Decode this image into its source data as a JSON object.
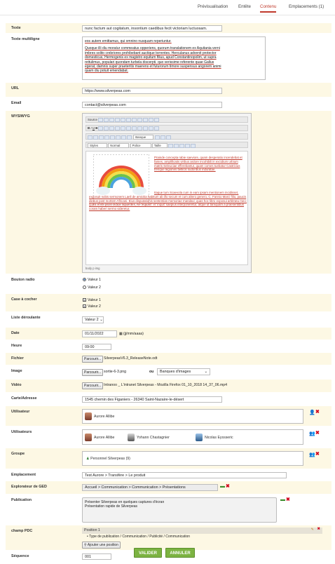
{
  "tabs": [
    {
      "label": "Prévisualisation"
    },
    {
      "label": "Entête"
    },
    {
      "label": "Contenu"
    },
    {
      "label": "Emplacements (1)"
    }
  ],
  "fields": {
    "texte": {
      "label": "Texte",
      "value": "nunc factum aut cogitatum, insontium caedibus fecit victoriam luctuosam."
    },
    "multiline": {
      "label": "Texte multiligne",
      "lines": [
        "eos autem emittamus, qui omnino nusquam reperiuntur.",
        "Quoque illi diu moratur commeatus opperiens, quorum translationem ex Aquitania verni",
        "imbres solito crebriores prohibebant auctique torrentes. Herculanus advenit protector",
        "domesticus, Hermogenis ex magistro equitum filius, apud Constantinopolim, ut supra",
        "rettulimus, populari quondam turbela discerpti. quo verissime referente quae Gallus",
        "egerat, damnis super praeteritis maerens et futurorum timore suspensus angorem animi",
        "quam diu potuit emendabat."
      ]
    },
    "url": {
      "label": "URL",
      "value": "https://www.silverpeas.com"
    },
    "email": {
      "label": "Email",
      "value": "contact@silverpeas.com"
    },
    "wysiwyg": {
      "label": "WYSIWYG",
      "toolbar": {
        "source": "Source",
        "font": "Banque",
        "styles": "Styles",
        "format": "Normal",
        "police": "Police",
        "size": "Taille"
      },
      "para1": "Prainde concepta rabie saeviore, quam desperatio incendebat et fames, amplificatis viribus ardore incohibili in excidium urbium matris Seleuciae efferebantur, quam comes tuebatur Castricius tresque legiones bellicis sudoribus induratae.",
      "para2": "Itaque tum Scaevola cum in eam ipsam mentionem incidisset, exposuit nobis sermonem Laeli de amicitia habitum ab illo secum et cum altero genero, C. Fannio Marci filio, paucis diebus post mortem Africani. Eius disputationis sententias memoriae mandavi, quas hoc libro exposui arbitratu meo; quasi enim ipsos induxi loquentes, ne 'inquam' et 'inquit' saepius interponeretur, atque ut tamquam a praesentibus coram haberi sermo videretur.",
      "status": "body  p  img"
    },
    "radio": {
      "label": "Bouton radio",
      "options": [
        "Valeur 1",
        "Valeur 2"
      ]
    },
    "checkbox": {
      "label": "Case à cocher",
      "options": [
        "Valeur 1",
        "Valeur 2"
      ]
    },
    "select": {
      "label": "Liste déroulante",
      "value": "Valeur 2"
    },
    "date": {
      "label": "Date",
      "value": "01/11/2022",
      "hint": "(jj/mm/aaaa)"
    },
    "heure": {
      "label": "Heure",
      "value": "09:00"
    },
    "fichier": {
      "label": "Fichier",
      "browse": "Parcourir...",
      "value": "SilverpeasV6.3_ReleaseNote.odt"
    },
    "image": {
      "label": "Image",
      "browse": "Parcourir...",
      "value": "sortie-6-3.png",
      "or": "ou",
      "bank": "Banques d'images"
    },
    "video": {
      "label": "Vidéo",
      "browse": "Parcourir...",
      "value": "Intranoo _ L'intranet Silverpeas - Mozilla Firefox 01_10_2018 14_37_06.mp4"
    },
    "carte": {
      "label": "Carte/Adresse",
      "value": "1545 chemin des Figaniers - 26340 Saint-Nazaire-le-désert"
    },
    "utilisateur": {
      "label": "Utilisateur",
      "user": "Aurore Allibe"
    },
    "utilisateurs": {
      "label": "Utilisateurs",
      "users": [
        "Aurore Allibe",
        "Yohann Chastagnier",
        "Nicolas Eyssseric"
      ]
    },
    "groupe": {
      "label": "Groupe",
      "value": "Personnel Silverpeas (9)"
    },
    "emplacement": {
      "label": "Emplacement",
      "value": "Test Aurore > Transfère > Le produit"
    },
    "ged": {
      "label": "Explorateur de GED",
      "value": "Accueil > Communication > Communication > Présentations"
    },
    "publication": {
      "label": "Publication",
      "lines": [
        "Présenter Silverpeas en quelques captures d'écran",
        "Présentation rapide de Silverpeas"
      ]
    },
    "pdc": {
      "label": "champ PDC",
      "position": "Position 1",
      "path": "Type de publication / Communication / Publicité / Communication",
      "add": "Ajouter une position"
    },
    "sequence": {
      "label": "Séquence",
      "value": "001"
    }
  },
  "actions": {
    "validate": "VALIDER",
    "cancel": "ANNULER"
  },
  "colors": {
    "accent": "#c0392b",
    "row_bg": "#fdf8e4",
    "button_green": "#7cb342",
    "link_red": "#c0392b"
  }
}
